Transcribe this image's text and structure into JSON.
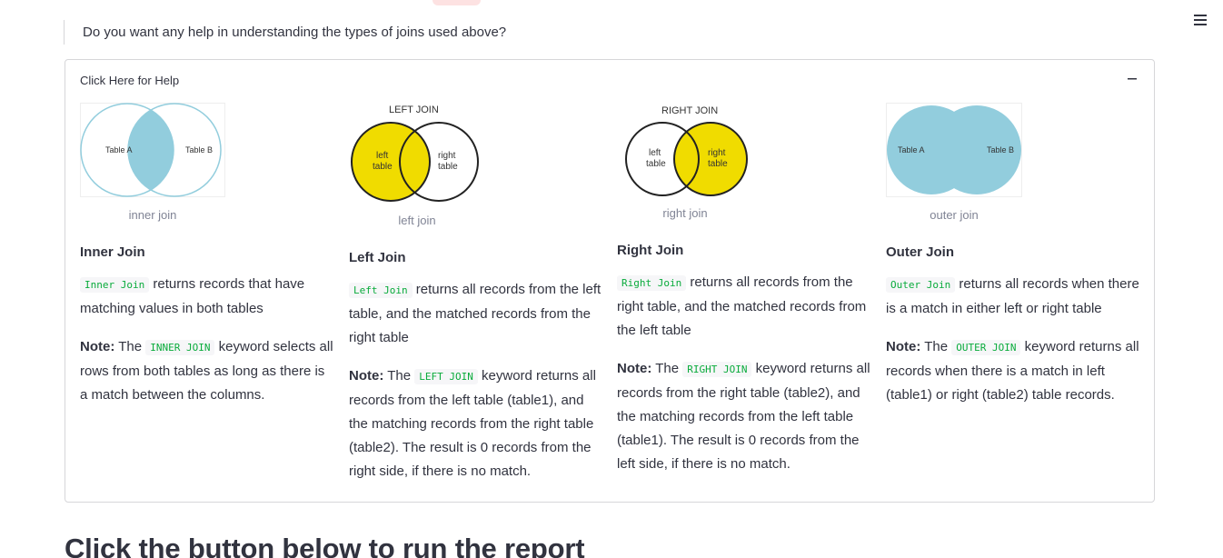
{
  "prompt_text": "Do you want any help in understanding the types of joins used above?",
  "expander": {
    "header": "Click Here for Help",
    "collapse_icon": "minus-icon"
  },
  "menu": {
    "icon": "hamburger-menu-icon"
  },
  "columns": [
    {
      "venn": {
        "left_label": "Table A",
        "right_label": "Table B",
        "heading": ""
      },
      "caption": "inner join",
      "title": "Inner Join",
      "desc_code": "Inner Join",
      "desc_text": " returns records that have matching values in both tables",
      "note_label": "Note:",
      "note_pre": " The ",
      "note_code": "INNER JOIN",
      "note_text": " keyword selects all rows from both tables as long as there is a match between the columns."
    },
    {
      "venn": {
        "heading": "LEFT JOIN",
        "left_label_1": "left",
        "left_label_2": "table",
        "right_label_1": "right",
        "right_label_2": "table"
      },
      "caption": "left join",
      "title": "Left Join",
      "desc_code": "Left Join",
      "desc_text": " returns all records from the left table, and the matched records from the right table",
      "note_label": "Note:",
      "note_pre": " The ",
      "note_code": "LEFT JOIN",
      "note_text": " keyword returns all records from the left table (table1), and the matching records from the right table (table2). The result is 0 records from the right side, if there is no match."
    },
    {
      "venn": {
        "heading": "RIGHT JOIN",
        "left_label_1": "left",
        "left_label_2": "table",
        "right_label_1": "right",
        "right_label_2": "table"
      },
      "caption": "right join",
      "title": "Right Join",
      "desc_code": "Right Join",
      "desc_text": " returns all records from the right table, and the matched records from the left table",
      "note_label": "Note:",
      "note_pre": " The ",
      "note_code": "RIGHT JOIN",
      "note_text": " keyword returns all records from the right table (table2), and the matching records from the left table (table1). The result is 0 records from the left side, if there is no match."
    },
    {
      "venn": {
        "left_label": "Table A",
        "right_label": "Table B",
        "heading": ""
      },
      "caption": "outer join",
      "title": "Outer Join",
      "desc_code": "Outer Join",
      "desc_text": " returns all records when there is a match in either left or right table",
      "note_label": "Note:",
      "note_pre": " The ",
      "note_code": "OUTER JOIN",
      "note_text": " keyword returns all records when there is a match in left (table1) or right (table2) table records."
    }
  ],
  "colors": {
    "venn_blue": "#92cddd",
    "venn_yellow": "#f0dc00",
    "code_green": "#09ab3b"
  },
  "report_title": "Click the button below to run the report"
}
